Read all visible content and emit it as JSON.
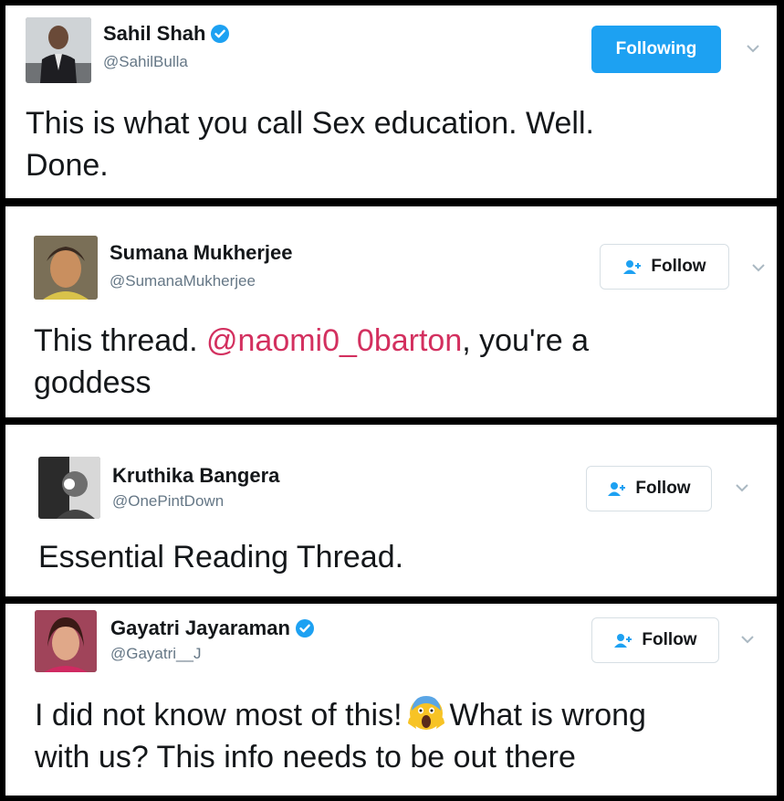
{
  "tweets": [
    {
      "name": "Sahil Shah",
      "verified": true,
      "handle": "@SahilBulla",
      "button": "Following",
      "text_line1": "This is what you call Sex education. Well.",
      "text_line2": "Done."
    },
    {
      "name": "Sumana Mukherjee",
      "verified": false,
      "handle": "@SumanaMukherjee",
      "button": "Follow",
      "text_line1_pre": "This thread. ",
      "text_line1_mention": "@naomi0_0barton",
      "text_line1_post": ", you're a",
      "text_line2": "goddess"
    },
    {
      "name": "Kruthika Bangera",
      "verified": false,
      "handle": "@OnePintDown",
      "button": "Follow",
      "text_line1": "Essential Reading Thread."
    },
    {
      "name": "Gayatri Jayaraman",
      "verified": true,
      "handle": "@Gayatri__J",
      "button": "Follow",
      "text_line1_pre": "I did not know most of this!",
      "text_line1_emoji": "screaming-face-emoji",
      "text_line1_post": "What is wrong",
      "text_line2": "with us? This info needs to be out there"
    }
  ],
  "colors": {
    "following_button": "#1da1f2",
    "verified_badge": "#1da1f2",
    "mention": "#d3305f",
    "handle": "#657786",
    "text": "#14171a"
  },
  "icons": {
    "verified": "verified-badge-icon",
    "follow": "add-user-icon",
    "menu": "chevron-down-icon"
  }
}
